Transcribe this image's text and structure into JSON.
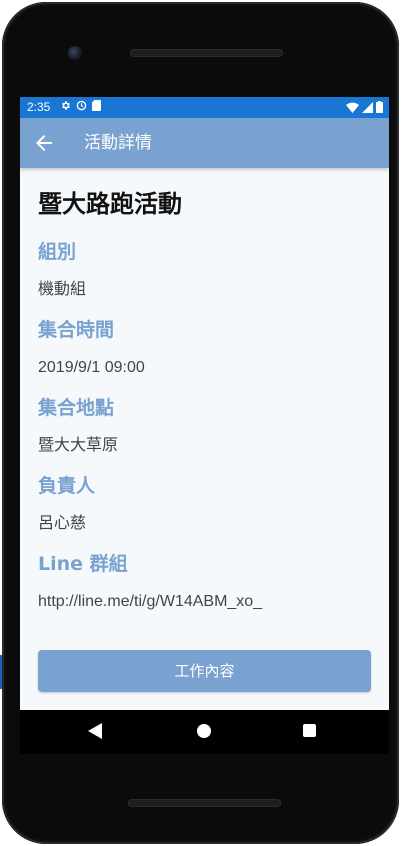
{
  "status_bar": {
    "time": "2:35",
    "left_icons": [
      "settings-icon",
      "sync-icon",
      "sd-card-icon"
    ],
    "right_icons": [
      "wifi-icon",
      "signal-icon",
      "battery-icon"
    ]
  },
  "app_bar": {
    "title": "活動詳情",
    "back_icon": "arrow-back-icon"
  },
  "event": {
    "title": "暨大路跑活動",
    "fields": [
      {
        "label": "組別",
        "value": "機動組"
      },
      {
        "label": "集合時間",
        "value": "2019/9/1 09:00"
      },
      {
        "label": "集合地點",
        "value": "暨大大草原"
      },
      {
        "label": "負責人",
        "value": "呂心慈"
      },
      {
        "label": "Line 群組",
        "value": "http://line.me/ti/g/W14ABM_xo_"
      }
    ]
  },
  "actions": {
    "work_content_label": "工作內容"
  },
  "nav_bar": {
    "icons": [
      "nav-back-icon",
      "nav-home-icon",
      "nav-recents-icon"
    ]
  },
  "colors": {
    "status_bar": "#1976d2",
    "app_bar": "#7aa2d0",
    "accent_label": "#7aa2d0",
    "screen_background": "#f5f9fc"
  }
}
